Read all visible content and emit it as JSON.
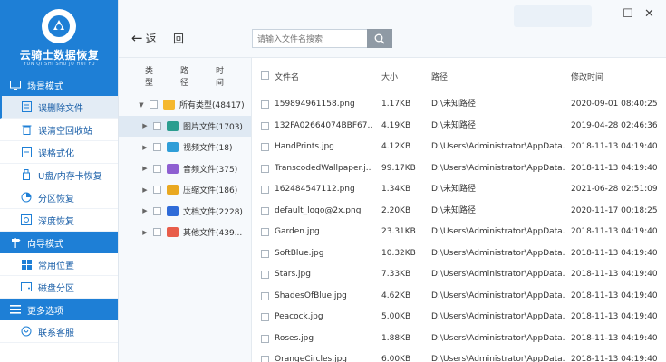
{
  "brand": {
    "title": "云骑士数据恢复",
    "subtitle": "YUN QI SHI SHU JU HUI FU"
  },
  "sidebar": {
    "sections": [
      {
        "label": "场景模式",
        "items": [
          "误删除文件",
          "误清空回收站",
          "误格式化",
          "U盘/内存卡恢复",
          "分区恢复",
          "深度恢复"
        ]
      },
      {
        "label": "向导模式",
        "items": [
          "常用位置",
          "磁盘分区"
        ]
      },
      {
        "label": "更多选项",
        "items": [
          "联系客服"
        ]
      }
    ]
  },
  "toolbar": {
    "back_label": "返",
    "refresh_label": "回",
    "search_placeholder": "请输入文件名搜索",
    "minimize": "—",
    "maximize": "☐",
    "close": "✕"
  },
  "tree": {
    "headers": [
      "类型",
      "路径",
      "时间"
    ],
    "items": [
      {
        "label": "所有类型(48417)",
        "color": "#f5b82e"
      },
      {
        "label": "图片文件(1703)",
        "color": "#2a9d8f"
      },
      {
        "label": "视频文件(18)",
        "color": "#2f9ed8"
      },
      {
        "label": "音频文件(375)",
        "color": "#8e5fd1"
      },
      {
        "label": "压缩文件(186)",
        "color": "#e9a820"
      },
      {
        "label": "文档文件(2228)",
        "color": "#2f6bd8"
      },
      {
        "label": "其他文件(439...",
        "color": "#e85d4a"
      }
    ]
  },
  "files": {
    "headers": {
      "name": "文件名",
      "size": "大小",
      "path": "路径",
      "date": "修改时间"
    },
    "rows": [
      {
        "name": "159894961158.png",
        "size": "1.17KB",
        "path": "D:\\未知路径",
        "date": "2020-09-01 08:40:25"
      },
      {
        "name": "132FA02664074BBF67...",
        "size": "4.19KB",
        "path": "D:\\未知路径",
        "date": "2019-04-28 02:46:36"
      },
      {
        "name": "HandPrints.jpg",
        "size": "4.12KB",
        "path": "D:\\Users\\Administrator\\AppData...",
        "date": "2018-11-13 04:19:40"
      },
      {
        "name": "TranscodedWallpaper.j...",
        "size": "99.17KB",
        "path": "D:\\Users\\Administrator\\AppData...",
        "date": "2018-11-13 04:19:40"
      },
      {
        "name": "162484547112.png",
        "size": "1.34KB",
        "path": "D:\\未知路径",
        "date": "2021-06-28 02:51:09"
      },
      {
        "name": "default_logo@2x.png",
        "size": "2.20KB",
        "path": "D:\\未知路径",
        "date": "2020-11-17 00:18:25"
      },
      {
        "name": "Garden.jpg",
        "size": "23.31KB",
        "path": "D:\\Users\\Administrator\\AppData...",
        "date": "2018-11-13 04:19:40"
      },
      {
        "name": "SoftBlue.jpg",
        "size": "10.32KB",
        "path": "D:\\Users\\Administrator\\AppData...",
        "date": "2018-11-13 04:19:40"
      },
      {
        "name": "Stars.jpg",
        "size": "7.33KB",
        "path": "D:\\Users\\Administrator\\AppData...",
        "date": "2018-11-13 04:19:40"
      },
      {
        "name": "ShadesOfBlue.jpg",
        "size": "4.62KB",
        "path": "D:\\Users\\Administrator\\AppData...",
        "date": "2018-11-13 04:19:40"
      },
      {
        "name": "Peacock.jpg",
        "size": "5.00KB",
        "path": "D:\\Users\\Administrator\\AppData...",
        "date": "2018-11-13 04:19:40"
      },
      {
        "name": "Roses.jpg",
        "size": "1.88KB",
        "path": "D:\\Users\\Administrator\\AppData...",
        "date": "2018-11-13 04:19:40"
      },
      {
        "name": "OrangeCircles.jpg",
        "size": "6.00KB",
        "path": "D:\\Users\\Administrator\\AppData...",
        "date": "2018-11-13 04:19:40"
      }
    ]
  },
  "colors": {
    "accent": "#1e7fd6"
  }
}
